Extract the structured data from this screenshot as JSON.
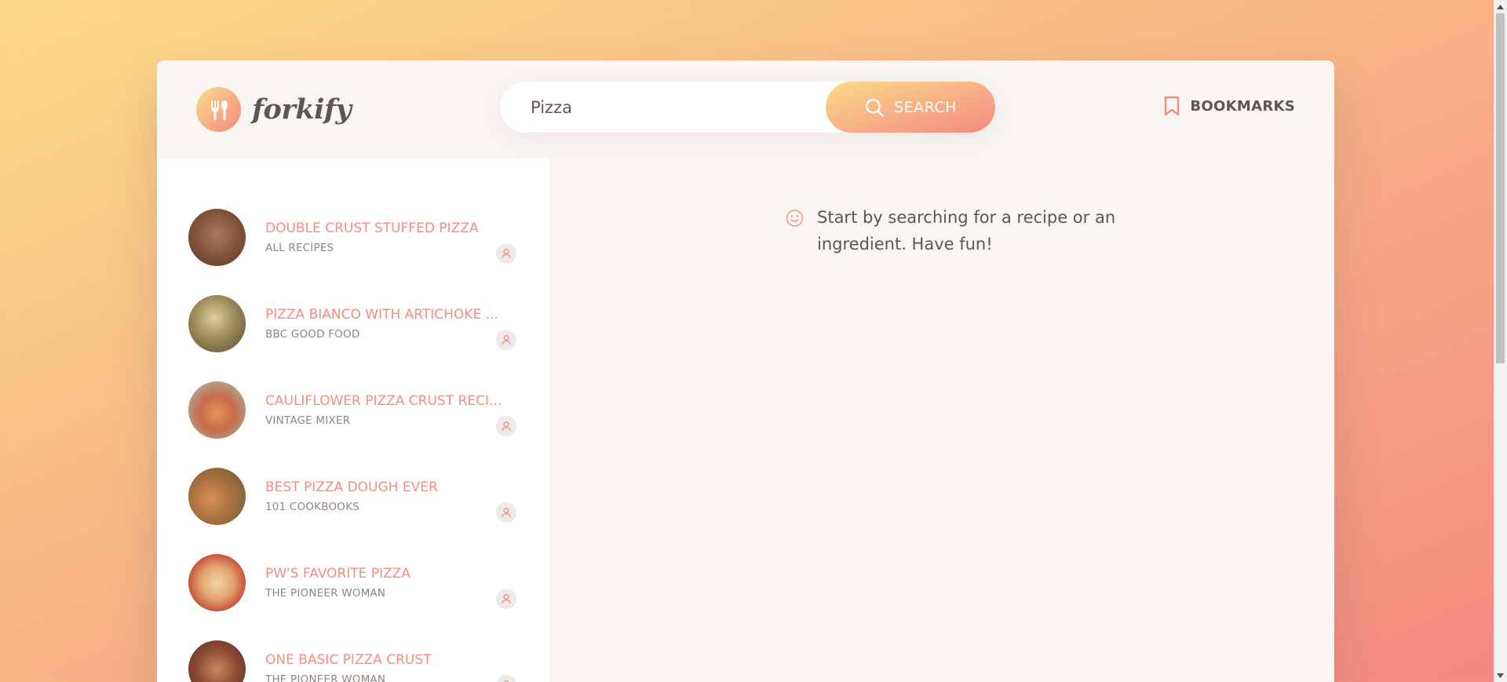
{
  "logo": {
    "text": "forkify"
  },
  "search": {
    "value": "Pizza",
    "button_label": "SEARCH"
  },
  "header": {
    "bookmarks_label": "BOOKMARKS"
  },
  "results": [
    {
      "title": "DOUBLE CRUST STUFFED PIZZA",
      "publisher": "ALL RECIPES"
    },
    {
      "title": "PIZZA BIANCO WITH ARTICHOKE ...",
      "publisher": "BBC GOOD FOOD"
    },
    {
      "title": "CAULIFLOWER PIZZA CRUST RECI...",
      "publisher": "VINTAGE MIXER"
    },
    {
      "title": "BEST PIZZA DOUGH EVER",
      "publisher": "101 COOKBOOKS"
    },
    {
      "title": "PW'S FAVORITE PIZZA",
      "publisher": "THE PIONEER WOMAN"
    },
    {
      "title": "ONE BASIC PIZZA CRUST",
      "publisher": "THE PIONEER WOMAN"
    }
  ],
  "message": {
    "text": "Start by searching for a recipe or an ingredient. Have fun!"
  },
  "colors": {
    "accent": "#f38e82",
    "gradient_start": "#fbdb89",
    "gradient_end": "#f48982",
    "text": "#615551"
  },
  "icons": {
    "logo": "fork-spoon-icon",
    "search": "search-icon",
    "bookmarks": "bookmark-icon",
    "user": "user-icon",
    "message": "smile-icon"
  }
}
